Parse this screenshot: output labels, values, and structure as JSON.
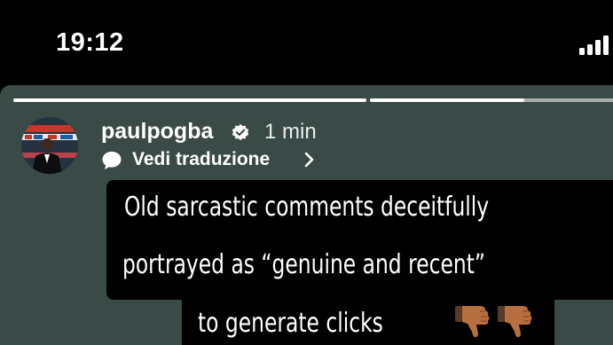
{
  "status_bar": {
    "time": "19:12"
  },
  "story": {
    "username": "paulpogba",
    "verified": true,
    "time_ago": "1 min",
    "translate_label": "Vedi traduzione",
    "progress": [
      1.0,
      0.6
    ],
    "caption_lines": [
      "Old sarcastic comments deceitfully",
      "portrayed as “genuine and recent”",
      "to generate clicks"
    ],
    "emojis": [
      "thumbs-down",
      "thumbs-down"
    ],
    "colors": {
      "background": "#3a4a47",
      "caption_box": "#000000",
      "text": "#ffffff",
      "emoji_skin": "#b86f3f"
    }
  }
}
